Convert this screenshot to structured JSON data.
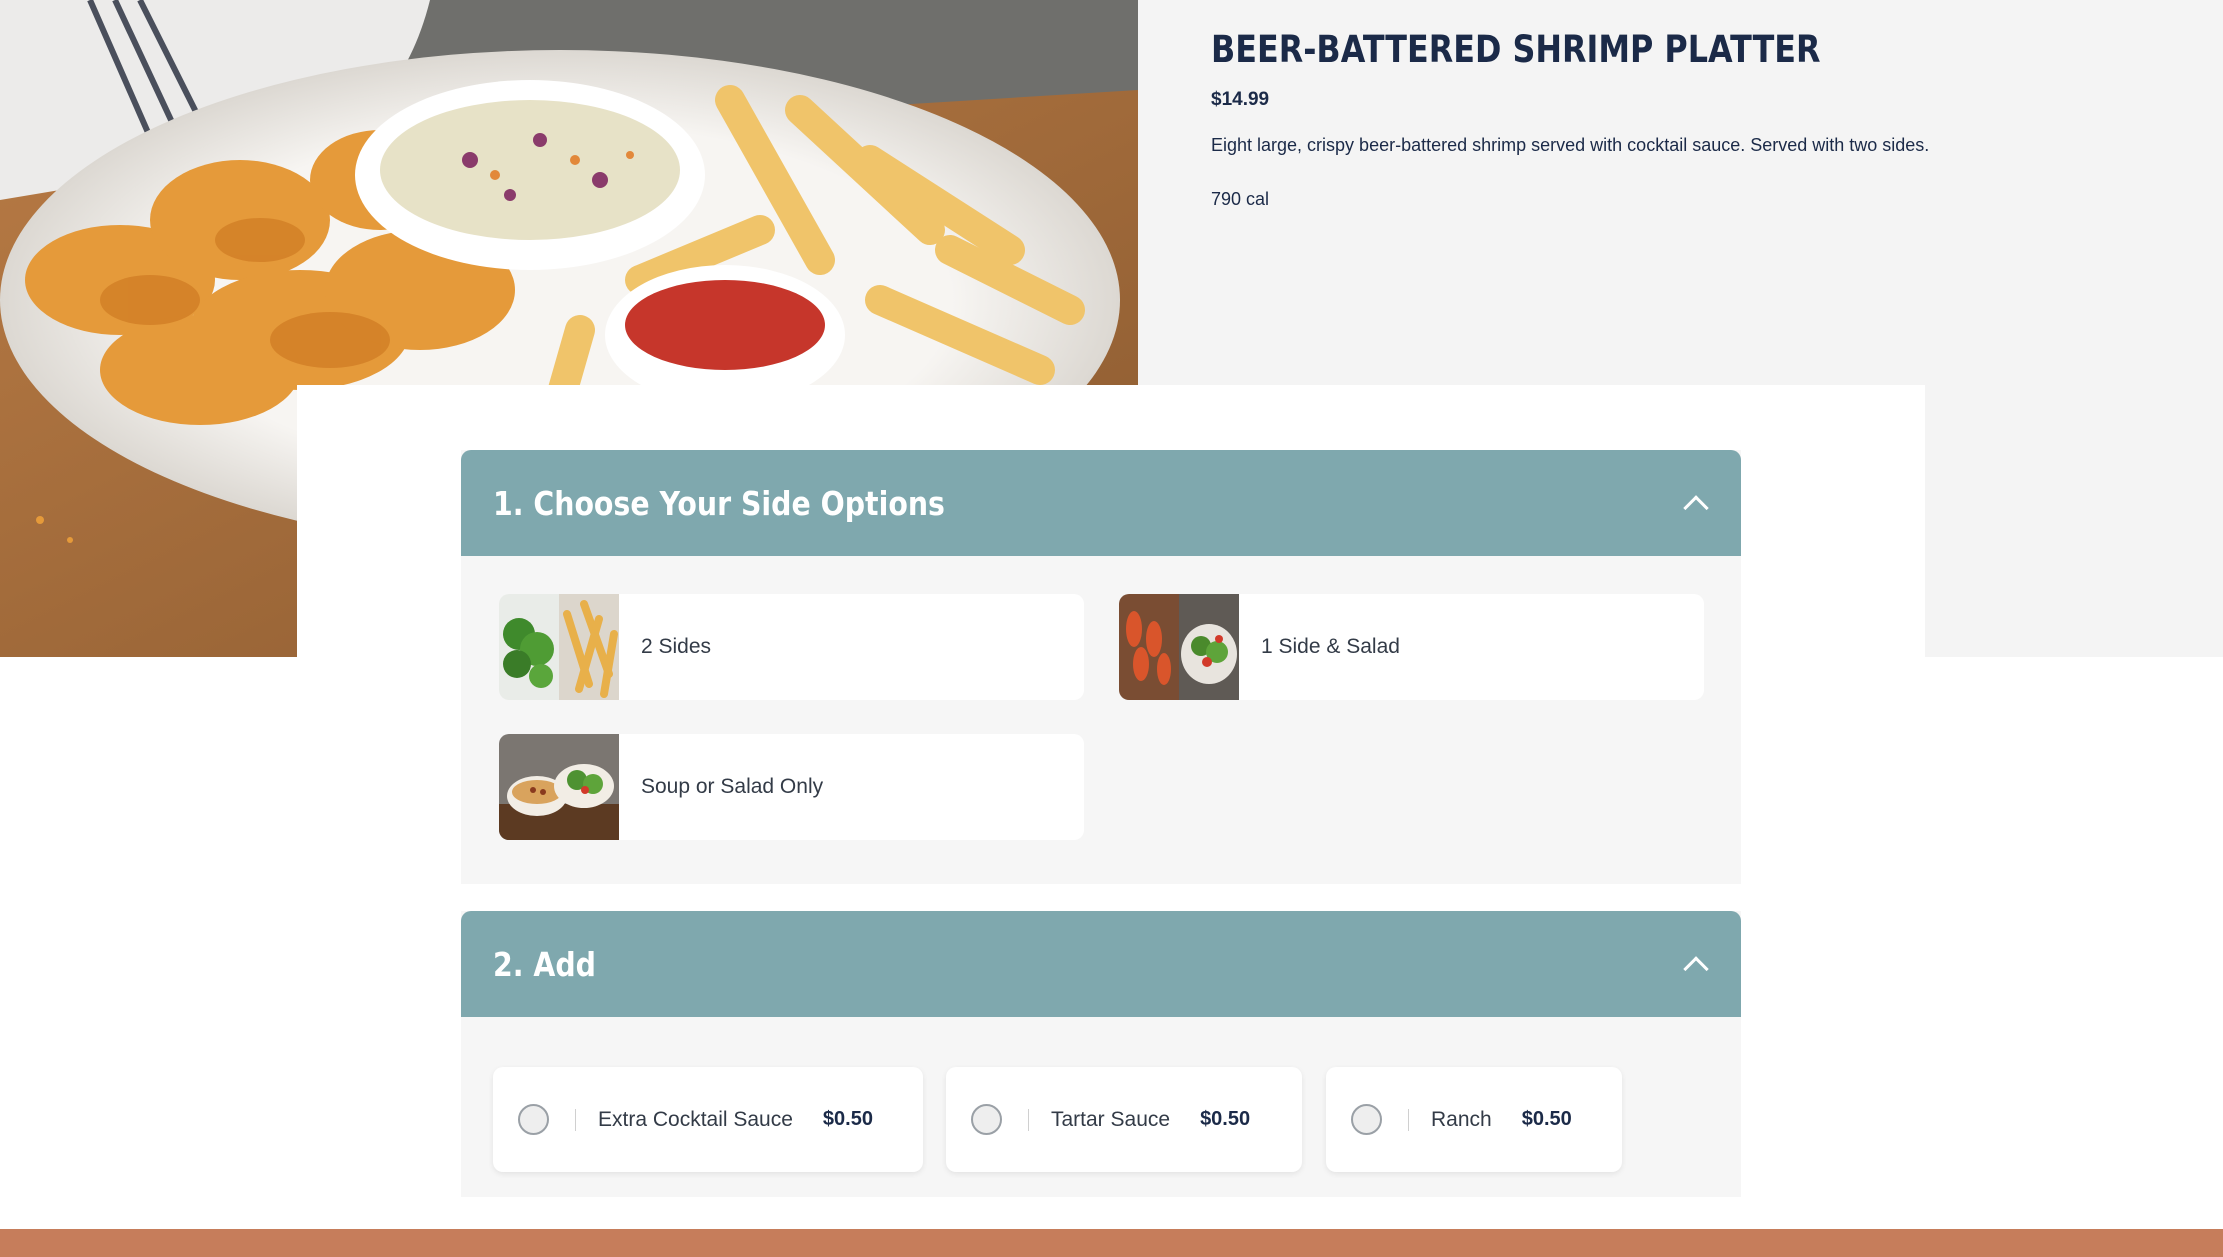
{
  "item": {
    "title": "BEER-BATTERED SHRIMP PLATTER",
    "price": "$14.99",
    "description": "Eight large, crispy beer-battered shrimp served with cocktail sauce. Served with two sides.",
    "calories": "790 cal"
  },
  "sections": {
    "side_options": {
      "title": "1. Choose Your Side Options",
      "options": [
        {
          "label": "2 Sides"
        },
        {
          "label": "1 Side & Salad"
        },
        {
          "label": "Soup or Salad Only"
        }
      ]
    },
    "add": {
      "title": "2. Add",
      "items": [
        {
          "label": "Extra Cocktail Sauce",
          "price": "$0.50"
        },
        {
          "label": "Tartar Sauce",
          "price": "$0.50"
        },
        {
          "label": "Ranch",
          "price": "$0.50"
        }
      ]
    }
  },
  "colors": {
    "section_header": "#7fa8ae",
    "title_text": "#1b2a48",
    "footer": "#c67d5b"
  },
  "icons": {
    "collapse": "chevron-up-icon",
    "radio": "radio-unchecked-icon"
  }
}
